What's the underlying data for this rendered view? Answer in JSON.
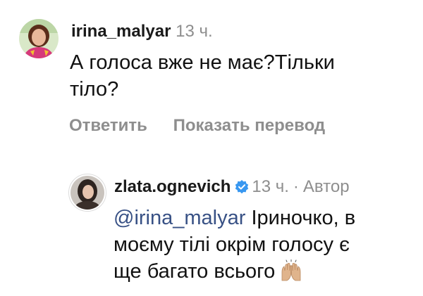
{
  "comment": {
    "username": "irina_malyar",
    "time": "13 ч.",
    "text_line1": "А голоса вже не має?Тільки",
    "text_line2": "тіло?",
    "reply_label": "Ответить",
    "translate_label": "Показать перевод"
  },
  "reply": {
    "username": "zlata.ognevich",
    "time": "13 ч.",
    "separator": "·",
    "author_label": "Автор",
    "mention": "@irina_malyar",
    "text_line1_rest": " Іриночко, в",
    "text_line2": "моєму тілі окрім голосу є",
    "text_line3": "ще багато всього",
    "emoji": "raising-hands"
  },
  "colors": {
    "username": "#1a1a1a",
    "meta": "#8e8e8e",
    "mention": "#385185",
    "verified": "#3897f0"
  }
}
